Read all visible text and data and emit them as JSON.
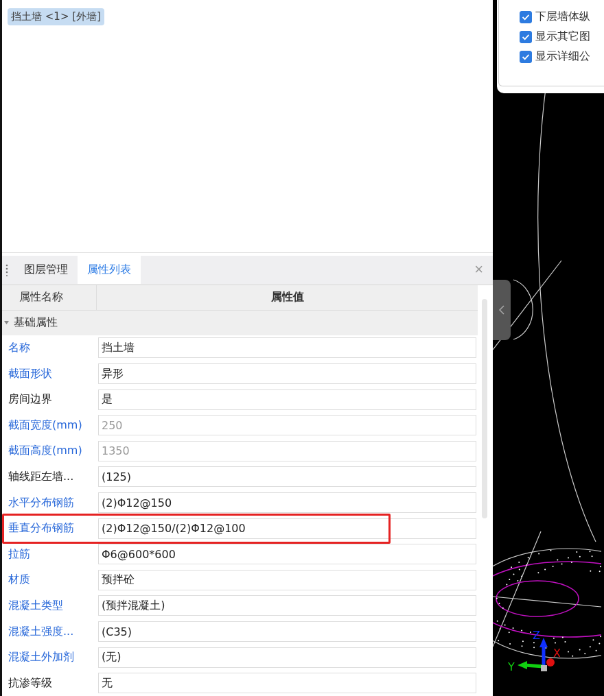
{
  "object_tag": {
    "label": "挡土墙 <1> [外墙]",
    "selected": true
  },
  "options_panel": {
    "checkboxes": [
      {
        "label": "下层墙体纵",
        "checked": true
      },
      {
        "label": "显示其它图",
        "checked": true
      },
      {
        "label": "显示详细公",
        "checked": true
      }
    ]
  },
  "panel_tabs": [
    {
      "label": "图层管理",
      "selected": false
    },
    {
      "label": "属性列表",
      "selected": true
    }
  ],
  "close_button": "×",
  "table": {
    "columns": [
      "属性名称",
      "属性值"
    ],
    "group": {
      "label": "基础属性",
      "expanded": true
    },
    "rows": [
      {
        "name": "名称",
        "value": "挡土墙",
        "public": true,
        "disabled": false,
        "highlighted": false
      },
      {
        "name": "截面形状",
        "value": "异形",
        "public": true,
        "disabled": false,
        "highlighted": false
      },
      {
        "name": "房间边界",
        "value": "是",
        "public": false,
        "disabled": false,
        "highlighted": false
      },
      {
        "name": "截面宽度(mm)",
        "value": "250",
        "public": true,
        "disabled": true,
        "highlighted": false
      },
      {
        "name": "截面高度(mm)",
        "value": "1350",
        "public": true,
        "disabled": true,
        "highlighted": false
      },
      {
        "name": "轴线距左墙...",
        "value": "(125)",
        "public": false,
        "disabled": false,
        "highlighted": false
      },
      {
        "name": "水平分布钢筋",
        "value": "(2)Φ12@150",
        "public": true,
        "disabled": false,
        "highlighted": false
      },
      {
        "name": "垂直分布钢筋",
        "value": "(2)Φ12@150/(2)Φ12@100",
        "public": true,
        "disabled": false,
        "highlighted": true
      },
      {
        "name": "拉筋",
        "value": "Φ6@600*600",
        "public": true,
        "disabled": false,
        "highlighted": false
      },
      {
        "name": "材质",
        "value": "预拌砼",
        "public": true,
        "disabled": false,
        "highlighted": false
      },
      {
        "name": "混凝土类型",
        "value": "(预拌混凝土)",
        "public": true,
        "disabled": false,
        "highlighted": false
      },
      {
        "name": "混凝土强度...",
        "value": "(C35)",
        "public": true,
        "disabled": false,
        "highlighted": false
      },
      {
        "name": "混凝土外加剂",
        "value": "(无)",
        "public": true,
        "disabled": false,
        "highlighted": false
      },
      {
        "name": "抗渗等级",
        "value": "无",
        "public": false,
        "disabled": false,
        "highlighted": false
      }
    ]
  },
  "viewport": {
    "axis_labels": {
      "x": "X",
      "y": "Y",
      "z": "Z"
    }
  }
}
